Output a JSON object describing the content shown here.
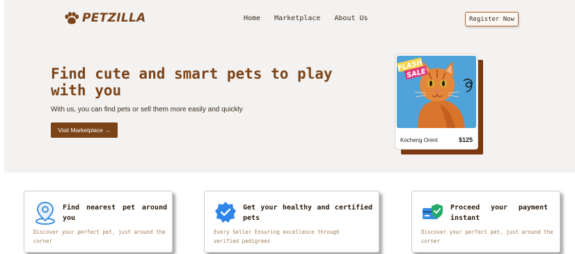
{
  "brand": {
    "name": "PETZILLA"
  },
  "nav": {
    "items": [
      "Home",
      "Marketplace",
      "About Us"
    ],
    "register_label": "Register Now"
  },
  "hero": {
    "title": "Find cute and smart pets to play with you",
    "subtitle": "With us, you can find pets or sell them more easily and quickly",
    "cta_label": "Visit Marketplace →"
  },
  "pet_card": {
    "badge_line1": "FLASH",
    "badge_line2": "SALE",
    "name": "Kocheng Orent",
    "price": "$125"
  },
  "features": [
    {
      "icon": "location-pin-icon",
      "title": "Find nearest pet around you",
      "description": "Discover your perfect pet, just around the corner"
    },
    {
      "icon": "verified-badge-icon",
      "title": "Get your healthy and certified pets",
      "description": "Every Seller Ensuring excellence through verified pedigrees"
    },
    {
      "icon": "secure-payment-icon",
      "title": "Proceed your payment instant",
      "description": "Discover your perfect pet, just around the corner"
    }
  ],
  "colors": {
    "brand_brown": "#7a4318",
    "hero_bg": "#f4f2f1",
    "card_shadow": "#7b3812",
    "muted_text": "#a07a55"
  }
}
